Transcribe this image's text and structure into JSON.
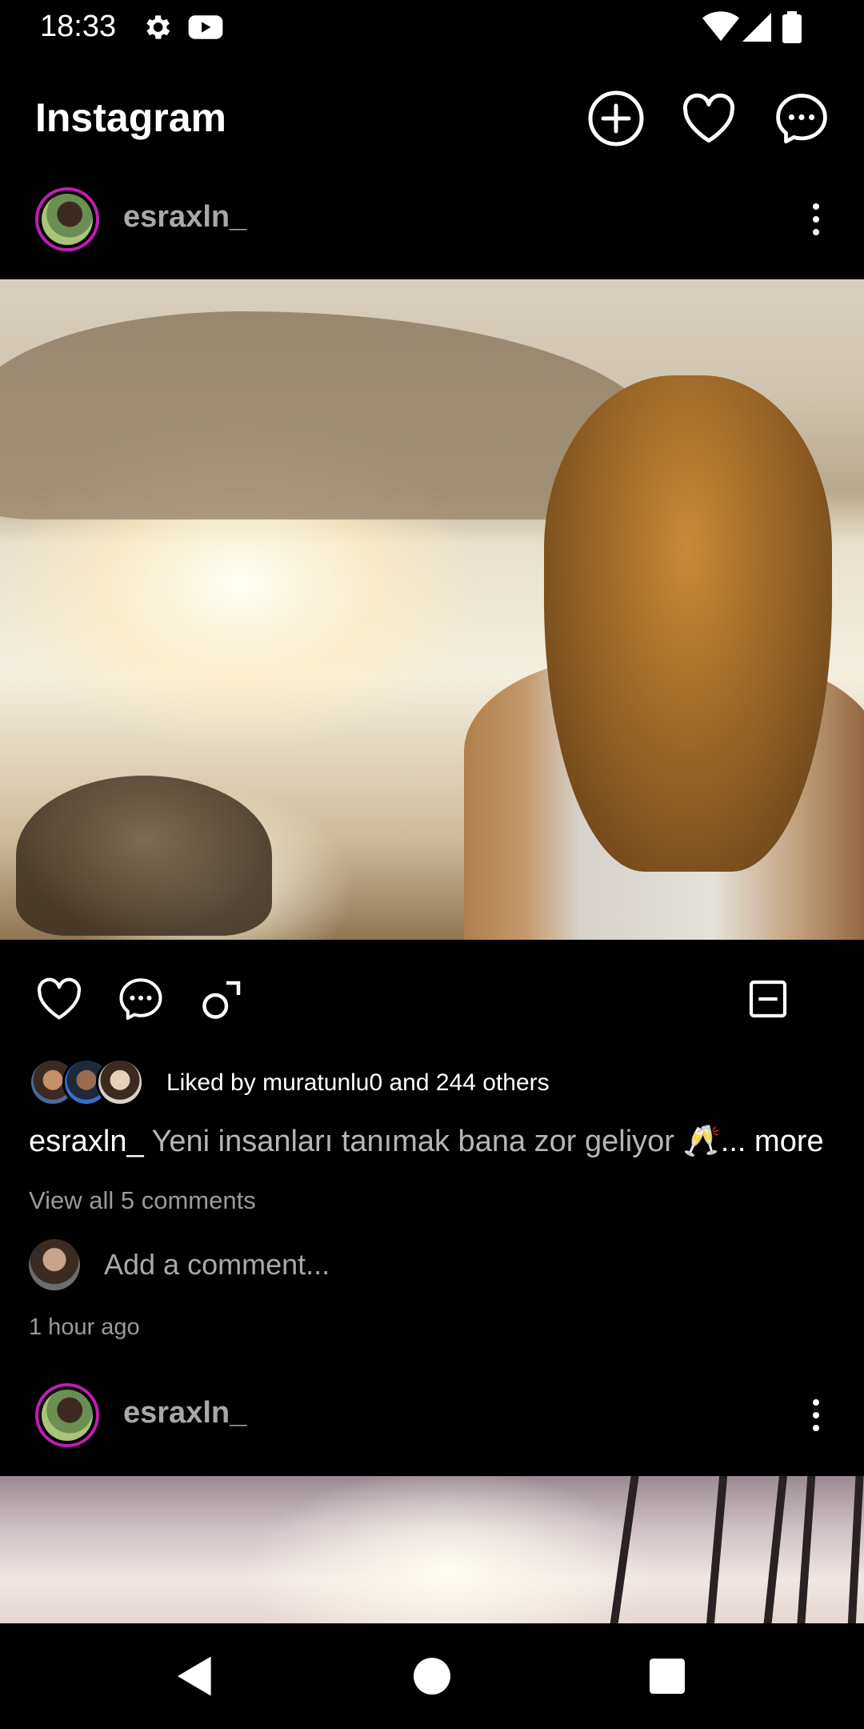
{
  "status_bar": {
    "time": "18:33",
    "icons": [
      "settings-icon",
      "youtube-icon",
      "wifi-icon",
      "signal-icon",
      "battery-icon"
    ]
  },
  "header": {
    "title": "Instagram",
    "actions": [
      "add-post-icon",
      "heart-icon",
      "messenger-icon"
    ]
  },
  "posts": [
    {
      "username": "esraxln_",
      "likes_text": "Liked by muratunlu0 and 244 others",
      "caption_user": "esraxln_",
      "caption_text": "Yeni insanları tanımak bana zor geliyor 🥂",
      "caption_more": "... more",
      "view_comments": "View all 5 comments",
      "comment_placeholder": "Add a comment...",
      "time_ago": "1 hour ago"
    },
    {
      "username": "esraxln_"
    }
  ],
  "colors": {
    "background": "#000000",
    "story_ring": "#c21cb5",
    "secondary_text": "#a8a8a8"
  },
  "nav": {
    "buttons": [
      "back-icon",
      "home-icon",
      "recents-icon"
    ]
  }
}
